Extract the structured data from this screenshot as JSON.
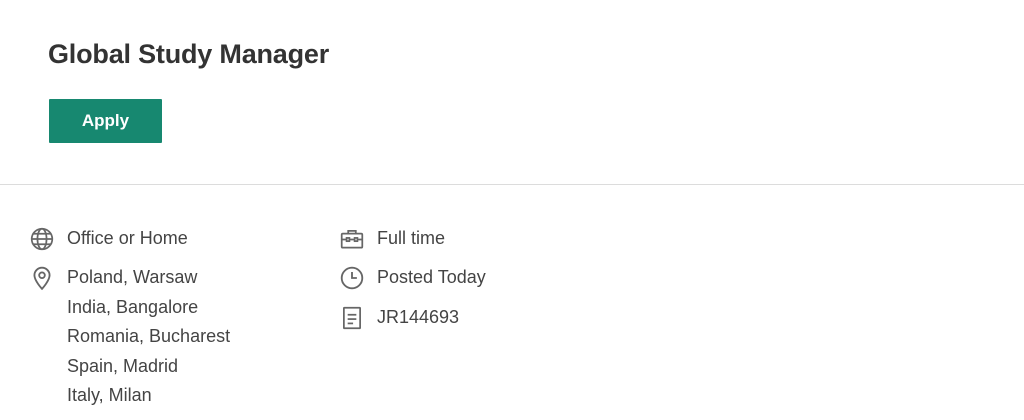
{
  "job": {
    "title": "Global Study Manager",
    "apply_label": "Apply"
  },
  "details": {
    "work_mode": "Office or Home",
    "locations": [
      "Poland, Warsaw",
      "India, Bangalore",
      "Romania, Bucharest",
      "Spain, Madrid",
      "Italy, Milan"
    ],
    "employment_type": "Full time",
    "posted": "Posted Today",
    "job_id": "JR144693"
  },
  "icons": {
    "work_mode": "globe-icon",
    "locations": "map-pin-icon",
    "employment_type": "briefcase-icon",
    "posted": "clock-icon",
    "job_id": "document-icon"
  },
  "colors": {
    "accent": "#178870",
    "icon": "#666666",
    "text": "#444444",
    "title": "#333333",
    "divider": "#dcdcdc"
  }
}
